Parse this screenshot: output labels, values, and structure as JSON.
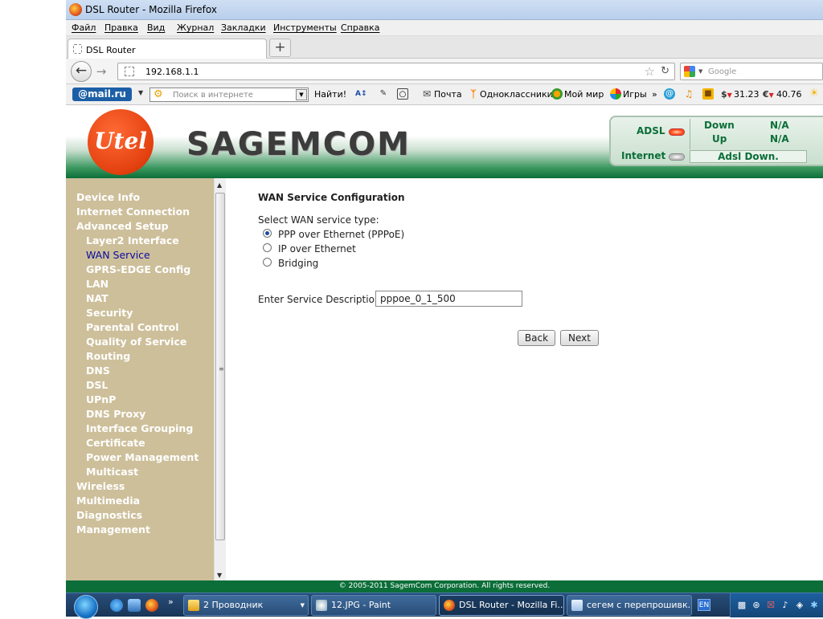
{
  "window": {
    "title": "DSL Router - Mozilla Firefox"
  },
  "menu": [
    "Файл",
    "Правка",
    "Вид",
    "Журнал",
    "Закладки",
    "Инструменты",
    "Справка"
  ],
  "tab": {
    "label": "DSL Router",
    "new_tab": "+"
  },
  "nav": {
    "url": "192.168.1.1",
    "search_placeholder": "Google"
  },
  "toolbar": {
    "mailru": "@mail.ru",
    "search_placeholder": "Поиск в интернете",
    "find": "Найти!",
    "mail": "Почта",
    "ok": "Одноклассники",
    "mymir": "Мой мир",
    "games": "Игры",
    "more": "»",
    "usd": "31.23",
    "eur": "40.76"
  },
  "header": {
    "brand_logo": "Utel",
    "brand": "SAGEMCOM",
    "status": {
      "adsl_label": "ADSL",
      "down_label": "Down",
      "up_label": "Up",
      "down_value": "N/A",
      "up_value": "N/A",
      "internet_label": "Internet",
      "line_status": "Adsl Down."
    },
    "colors": {
      "adsl_led": "#ff4a1a",
      "internet_led": "#bdbdbd",
      "brand_green": "#0b6e38"
    }
  },
  "sidebar": {
    "items": [
      {
        "label": "Device Info",
        "level": 1
      },
      {
        "label": "Internet Connection",
        "level": 1
      },
      {
        "label": "Advanced Setup",
        "level": 1
      },
      {
        "label": "Layer2 Interface",
        "level": 2
      },
      {
        "label": "WAN Service",
        "level": 2,
        "active": true
      },
      {
        "label": "GPRS-EDGE Config",
        "level": 2
      },
      {
        "label": "LAN",
        "level": 2
      },
      {
        "label": "NAT",
        "level": 2
      },
      {
        "label": "Security",
        "level": 2
      },
      {
        "label": "Parental Control",
        "level": 2
      },
      {
        "label": "Quality of Service",
        "level": 2
      },
      {
        "label": "Routing",
        "level": 2
      },
      {
        "label": "DNS",
        "level": 2
      },
      {
        "label": "DSL",
        "level": 2
      },
      {
        "label": "UPnP",
        "level": 2
      },
      {
        "label": "DNS Proxy",
        "level": 2
      },
      {
        "label": "Interface Grouping",
        "level": 2
      },
      {
        "label": "Certificate",
        "level": 2
      },
      {
        "label": "Power Management",
        "level": 2
      },
      {
        "label": "Multicast",
        "level": 2
      },
      {
        "label": "Wireless",
        "level": 1
      },
      {
        "label": "Multimedia",
        "level": 1
      },
      {
        "label": "Diagnostics",
        "level": 1
      },
      {
        "label": "Management",
        "level": 1
      }
    ]
  },
  "main": {
    "heading": "WAN Service Configuration",
    "select_label": "Select WAN service type:",
    "options": [
      {
        "label": "PPP over Ethernet (PPPoE)",
        "selected": true
      },
      {
        "label": "IP over Ethernet",
        "selected": false
      },
      {
        "label": "Bridging",
        "selected": false
      }
    ],
    "description_label": "Enter Service Description:",
    "description_value": "pppoe_0_1_500",
    "back": "Back",
    "next": "Next"
  },
  "footer": {
    "copyright": "© 2005-2011 SagemCom Corporation. All rights reserved."
  },
  "taskbar": {
    "tasks": [
      {
        "label": "2 Проводник"
      },
      {
        "label": "12.JPG - Paint"
      },
      {
        "label": "DSL Router - Mozilla Fi...",
        "active": true
      },
      {
        "label": "сегем с перепрошивк..."
      }
    ],
    "lang": "EN",
    "more": "»"
  }
}
